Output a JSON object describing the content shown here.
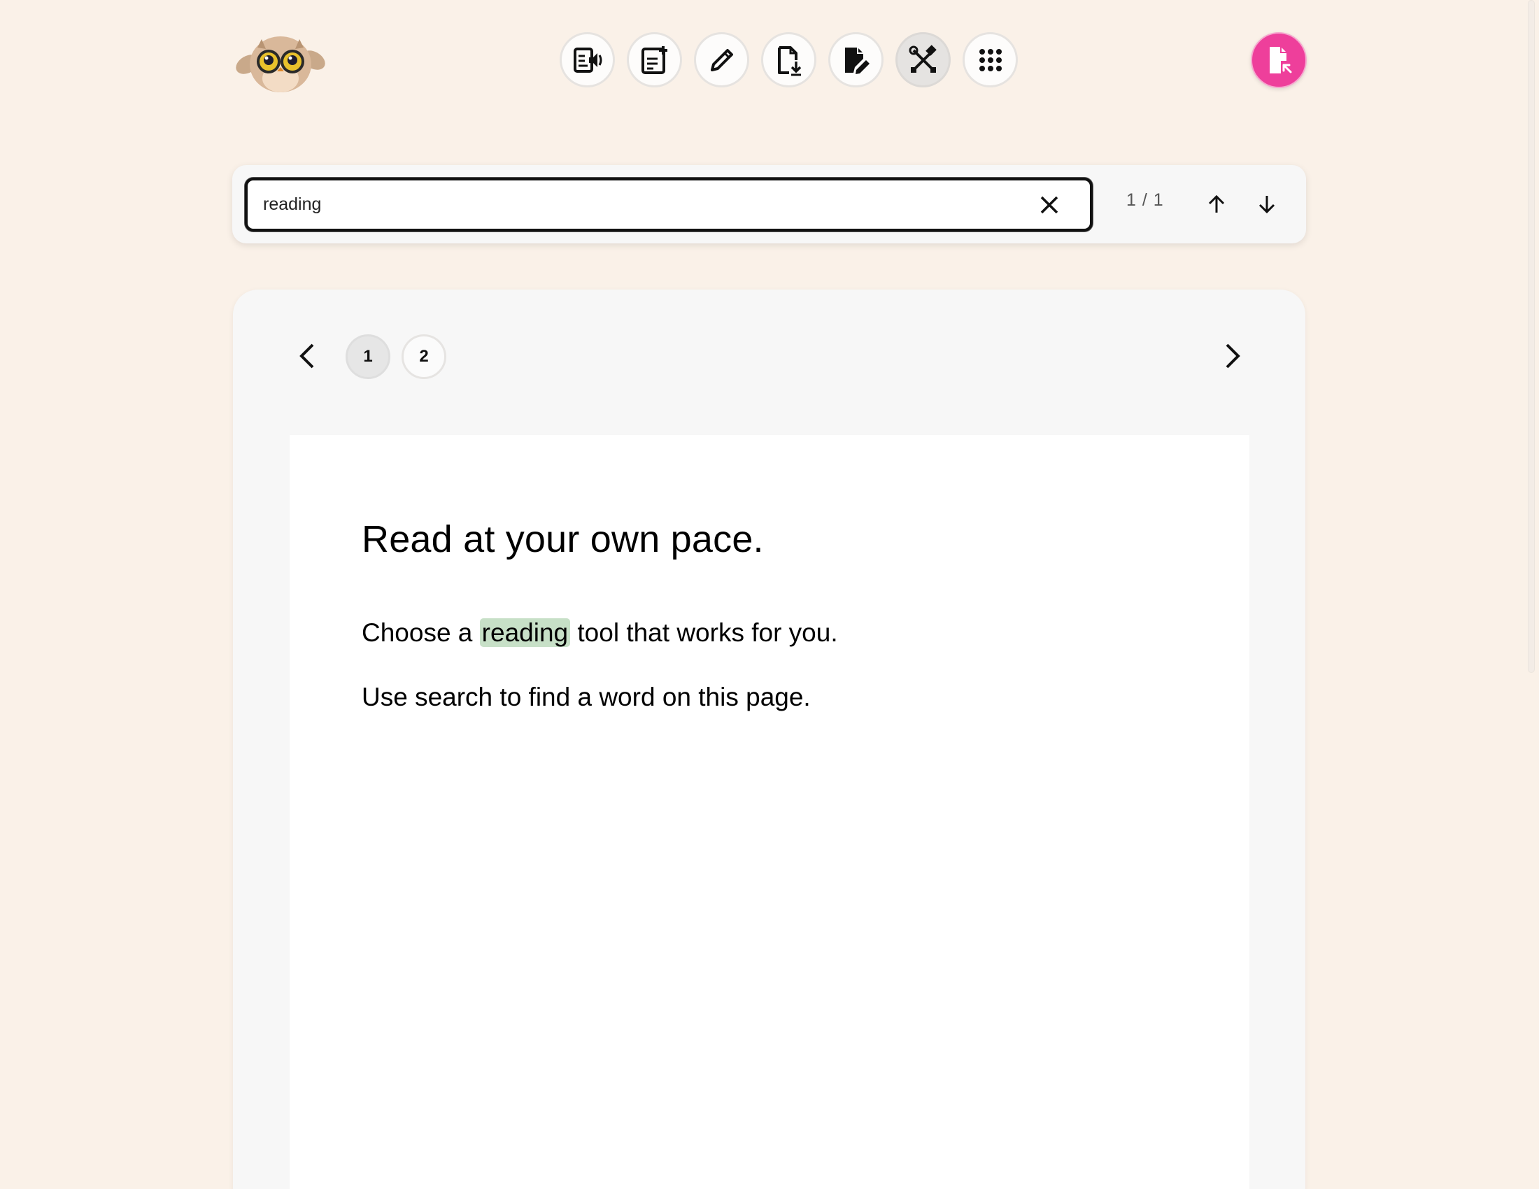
{
  "toolbar": {
    "buttons": [
      {
        "name": "read-aloud",
        "icon": "read-aloud-icon"
      },
      {
        "name": "add-notes",
        "icon": "add-note-icon"
      },
      {
        "name": "draw",
        "icon": "pencil-icon"
      },
      {
        "name": "download",
        "icon": "file-download-icon"
      },
      {
        "name": "edit-document",
        "icon": "file-edit-icon"
      },
      {
        "name": "tools",
        "icon": "tools-icon",
        "active": true
      },
      {
        "name": "apps",
        "icon": "grid-icon"
      }
    ]
  },
  "user": {
    "icon": "file-export-icon",
    "color": "#ee3f9b"
  },
  "search": {
    "value": "reading",
    "match_count": "1 / 1"
  },
  "pagination": {
    "pages": [
      "1",
      "2"
    ],
    "current": "1"
  },
  "document": {
    "title": "Read at your own pace.",
    "para1_before": "Choose a ",
    "para1_highlight": "reading",
    "para1_after": " tool that works for you.",
    "para2": "Use search to find a word on this page."
  },
  "colors": {
    "background": "#faf1e8",
    "accent": "#ee3f9b",
    "highlight": "#c7e0c7"
  }
}
